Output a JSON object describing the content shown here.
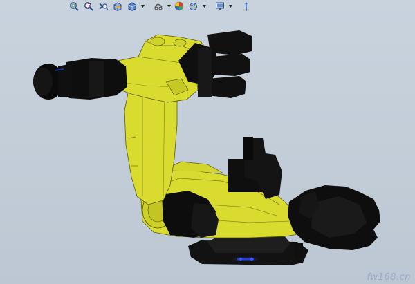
{
  "toolbar": {
    "buttons": [
      {
        "name": "zoom-to-fit-icon"
      },
      {
        "name": "zoom-to-area-icon"
      },
      {
        "name": "previous-view-icon"
      },
      {
        "name": "section-view-icon"
      },
      {
        "name": "view-orientation-icon",
        "has_dropdown": true
      },
      {
        "name": "display-style-icon",
        "has_dropdown": true
      },
      {
        "name": "hide-show-items-icon",
        "has_dropdown": true
      },
      {
        "name": "edit-appearance-icon"
      },
      {
        "name": "apply-scene-icon",
        "has_dropdown": true
      },
      {
        "name": "view-settings-icon",
        "has_dropdown": true
      },
      {
        "name": "triad-icon"
      }
    ]
  },
  "viewport": {
    "model": "industrial-robot-arm",
    "body_color": "#d9dc2f",
    "dark_parts_color": "#111111"
  },
  "watermark": {
    "text": "fw168.cn"
  }
}
